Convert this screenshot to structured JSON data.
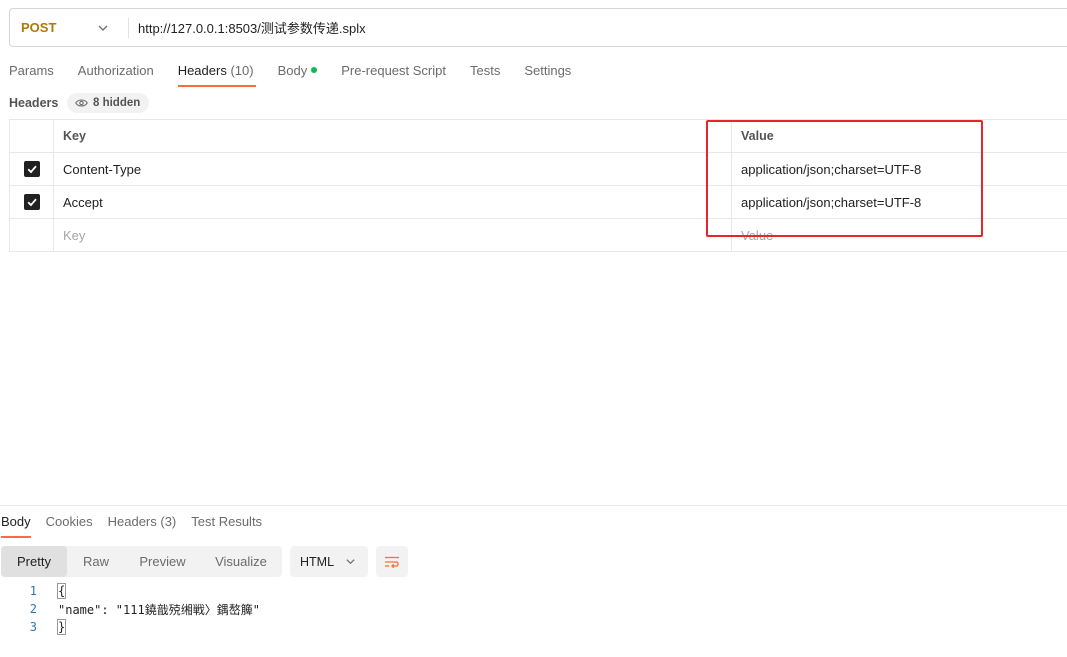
{
  "request": {
    "method": "POST",
    "url": "http://127.0.0.1:8503/测试参数传递.splx"
  },
  "request_tabs": [
    {
      "label": "Params"
    },
    {
      "label": "Authorization"
    },
    {
      "label": "Headers",
      "count": "(10)",
      "active": true
    },
    {
      "label": "Body",
      "has_dot": true
    },
    {
      "label": "Pre-request Script"
    },
    {
      "label": "Tests"
    },
    {
      "label": "Settings"
    }
  ],
  "headers_section": {
    "title": "Headers",
    "hidden_label": "8 hidden",
    "columns": {
      "key": "Key",
      "value": "Value"
    },
    "rows": [
      {
        "checked": true,
        "key": "Content-Type",
        "value": "application/json;charset=UTF-8"
      },
      {
        "checked": true,
        "key": "Accept",
        "value": "application/json;charset=UTF-8"
      }
    ],
    "new_row": {
      "key_placeholder": "Key",
      "value_placeholder": "Value"
    }
  },
  "response_tabs": [
    {
      "label": "Body",
      "active": true
    },
    {
      "label": "Cookies"
    },
    {
      "label": "Headers (3)"
    },
    {
      "label": "Test Results"
    }
  ],
  "view_modes": [
    {
      "label": "Pretty",
      "active": true
    },
    {
      "label": "Raw"
    },
    {
      "label": "Preview"
    },
    {
      "label": "Visualize"
    }
  ],
  "format": "HTML",
  "code_lines": [
    {
      "n": "1",
      "text": "{"
    },
    {
      "n": "2",
      "text": "\"name\": \"111鐃戠殑缃戦〉鍝嶅簲\""
    },
    {
      "n": "3",
      "text": "}"
    }
  ],
  "colors": {
    "accent": "#ff6c37",
    "method": "#ad7a03",
    "highlight": "#e6262b",
    "body_dot": "#0cbb52"
  }
}
